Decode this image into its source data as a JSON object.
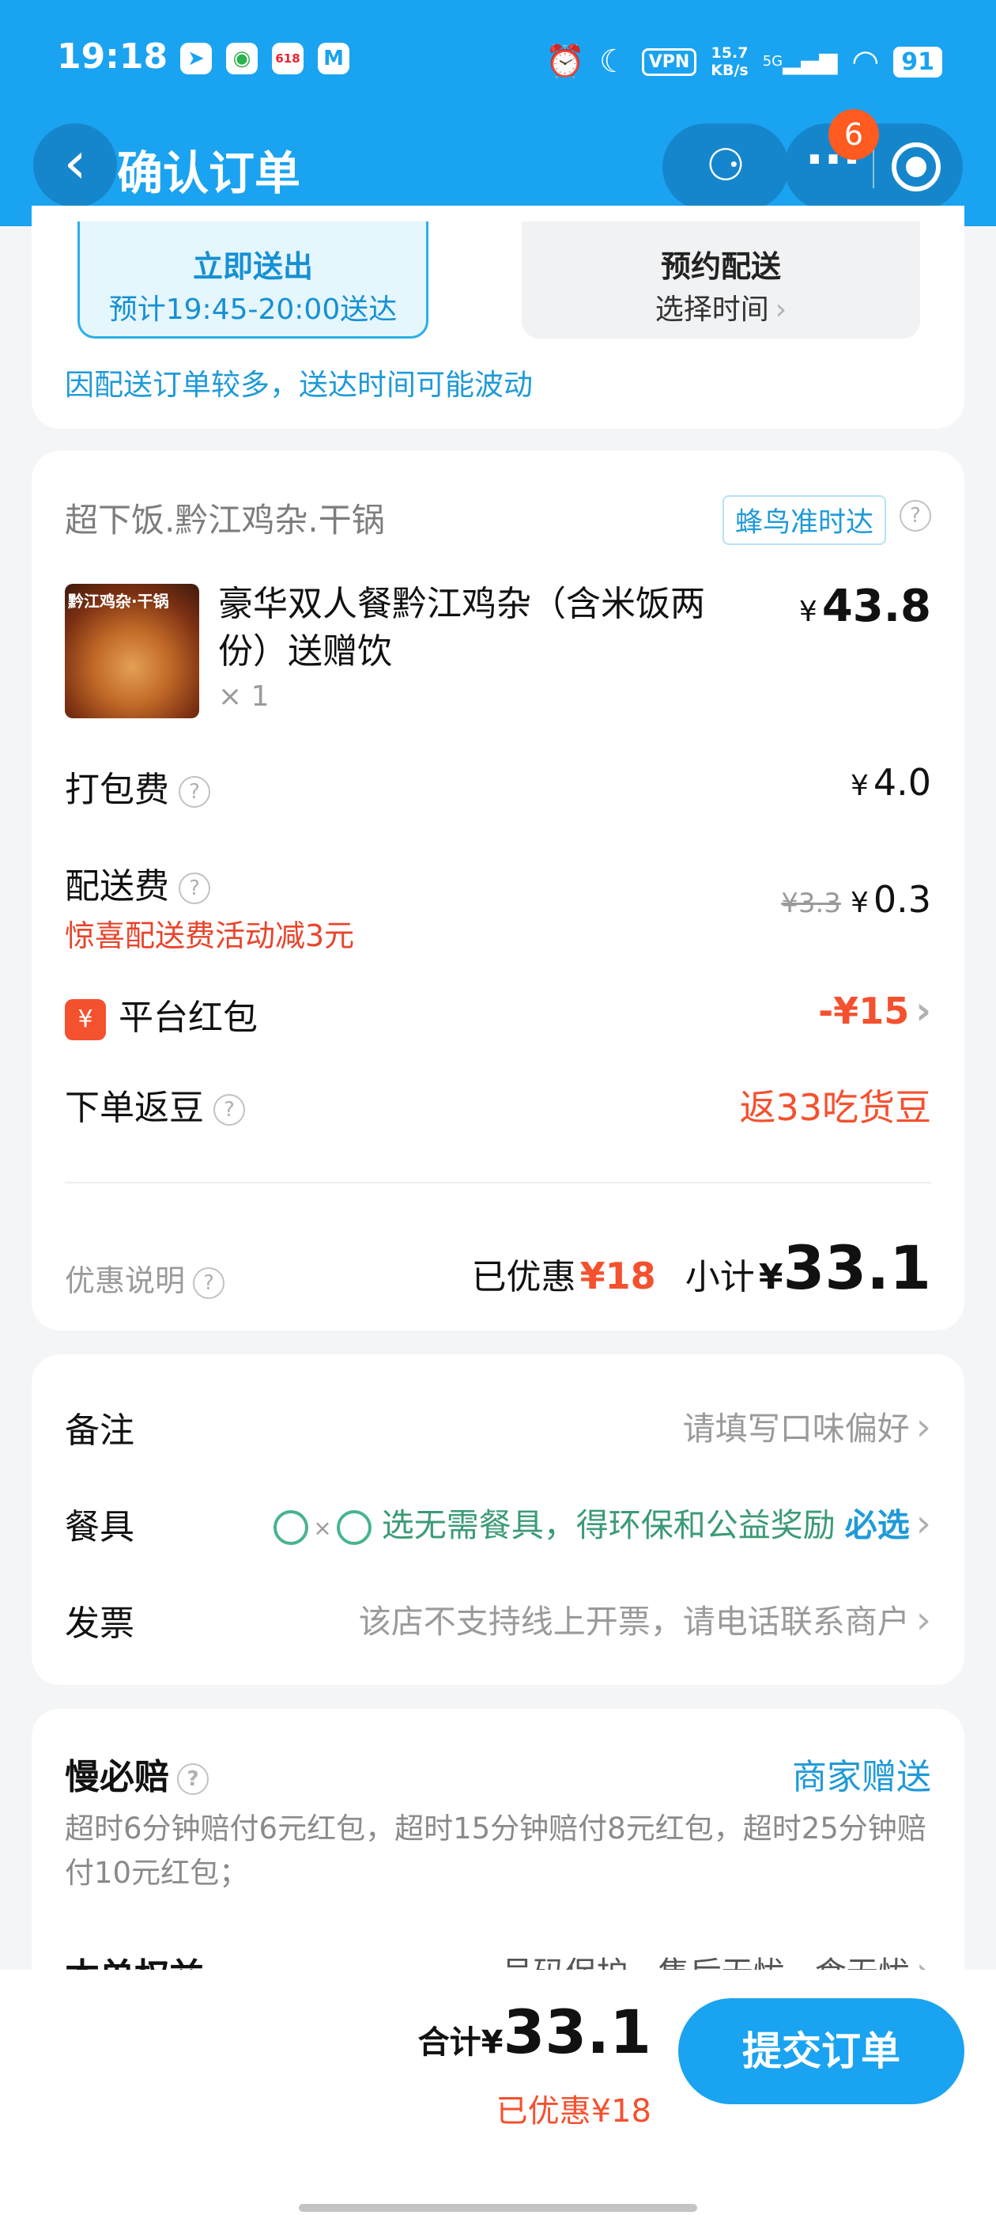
{
  "status_bar": {
    "time": "19:18",
    "net_speed_value": "15.7",
    "net_speed_unit": "KB/s",
    "signal_label": "5G",
    "vpn_label": "VPN",
    "battery": "91",
    "badge_618": "618"
  },
  "header": {
    "title": "确认订单",
    "menu_badge": "6"
  },
  "delivery": {
    "now_title": "立即送出",
    "now_eta": "预计19:45-20:00送达",
    "scheduled_title": "预约配送",
    "scheduled_action": "选择时间",
    "delay_tip": "因配送订单较多，送达时间可能波动"
  },
  "order": {
    "shop_name": "超下饭.黔江鸡杂.干锅",
    "on_time_tag": "蜂鸟准时达",
    "item": {
      "image_label": "黔江鸡杂·干锅",
      "name": "豪华双人餐黔江鸡杂（含米饭两份）送赠饮",
      "quantity": "× 1",
      "currency": "¥",
      "price": "43.8"
    },
    "packing_fee_label": "打包费",
    "packing_fee": "4.0",
    "delivery_fee_label": "配送费",
    "delivery_fee_original": "¥3.3",
    "delivery_fee": "0.3",
    "delivery_promo": "惊喜配送费活动减3元",
    "red_packet_icon": "¥",
    "red_packet_label": "平台红包",
    "red_packet_value": "-¥15",
    "beans_label": "下单返豆",
    "beans_value": "返33吃货豆",
    "discount_explain": "优惠说明",
    "discounted_label": "已优惠",
    "discounted_amount": "¥18",
    "subtotal_label": "小计",
    "subtotal_currency": "¥",
    "subtotal": "33.1"
  },
  "extras": {
    "remark_label": "备注",
    "remark_placeholder": "请填写口味偏好",
    "tableware_label": "餐具",
    "tableware_text": "选无需餐具，得环保和公益奖励",
    "tableware_required": "必选",
    "invoice_label": "发票",
    "invoice_text": "该店不支持线上开票，请电话联系商户"
  },
  "compensation": {
    "title": "慢必赔",
    "gift_label": "商家赠送",
    "description": "超时6分钟赔付6元红包，超时15分钟赔付8元红包，超时25分钟赔付10元红包；",
    "rights_label": "本单权益",
    "rights_value": "号码保护 · 售后无忧 · 食无忧"
  },
  "bottom_bar": {
    "total_label": "合计",
    "total_currency": "¥",
    "total": "33.1",
    "saved": "已优惠¥18",
    "submit_label": "提交订单"
  },
  "colors": {
    "primary": "#1aa3f0",
    "discount_red": "#f4512f",
    "eco_green": "#3b9b74"
  }
}
